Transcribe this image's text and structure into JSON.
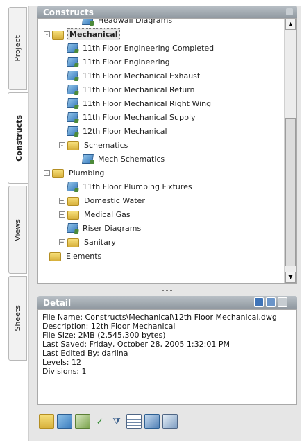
{
  "tabs": [
    {
      "label": "Project",
      "active": false
    },
    {
      "label": "Constructs",
      "active": true
    },
    {
      "label": "Views",
      "active": false
    },
    {
      "label": "Sheets",
      "active": false
    }
  ],
  "constructs_panel": {
    "title": "Constructs",
    "tree": [
      {
        "label": "Headwall Diagrams",
        "type": "drawing",
        "level": 2
      },
      {
        "label": "Mechanical",
        "type": "folder",
        "level": 0,
        "expander": "-",
        "selected": true
      },
      {
        "label": "11th Floor Engineering Completed",
        "type": "drawing",
        "level": 1
      },
      {
        "label": "11th Floor Engineering",
        "type": "drawing",
        "level": 1
      },
      {
        "label": "11th Floor Mechanical Exhaust",
        "type": "drawing",
        "level": 1
      },
      {
        "label": "11th Floor Mechanical Return",
        "type": "drawing",
        "level": 1
      },
      {
        "label": "11th Floor Mechanical Right Wing",
        "type": "drawing",
        "level": 1
      },
      {
        "label": "11th Floor Mechanical Supply",
        "type": "drawing",
        "level": 1
      },
      {
        "label": "12th Floor Mechanical",
        "type": "drawing",
        "level": 1
      },
      {
        "label": "Schematics",
        "type": "folder",
        "level": 1,
        "expander": "-"
      },
      {
        "label": "Mech Schematics",
        "type": "drawing",
        "level": 2
      },
      {
        "label": "Plumbing",
        "type": "folder",
        "level": 0,
        "expander": "-"
      },
      {
        "label": "11th Floor Plumbing Fixtures",
        "type": "drawing",
        "level": 1
      },
      {
        "label": "Domestic Water",
        "type": "folder",
        "level": 1,
        "expander": "+"
      },
      {
        "label": "Medical Gas",
        "type": "folder",
        "level": 1,
        "expander": "+"
      },
      {
        "label": "Riser Diagrams",
        "type": "drawing",
        "level": 1
      },
      {
        "label": "Sanitary",
        "type": "folder",
        "level": 1,
        "expander": "+"
      },
      {
        "label": "Elements",
        "type": "folder",
        "level": -1
      }
    ],
    "scrollbar": {
      "up_icon": "up-arrow-icon",
      "down_icon": "down-arrow-icon"
    }
  },
  "detail_panel": {
    "title": "Detail",
    "lines": [
      "File Name: Constructs\\Mechanical\\12th Floor Mechanical.dwg",
      "Description: 12th Floor Mechanical",
      "File Size: 2MB (2,545,300 bytes)",
      "Last Saved: Friday, October 28, 2005  1:32:01 PM",
      "Last Edited By: darlina",
      "Levels: 12",
      "Divisions: 1"
    ]
  },
  "toolbar_icons": [
    "add-folder-icon",
    "add-construct-icon",
    "add-element-icon",
    "check-icon",
    "filter-icon",
    "table-icon",
    "repath-icon",
    "copy-icon"
  ],
  "colors": {
    "titlebar": "#9aa2a9",
    "folder": "#e8c552",
    "drawing": "#4a86c5"
  }
}
